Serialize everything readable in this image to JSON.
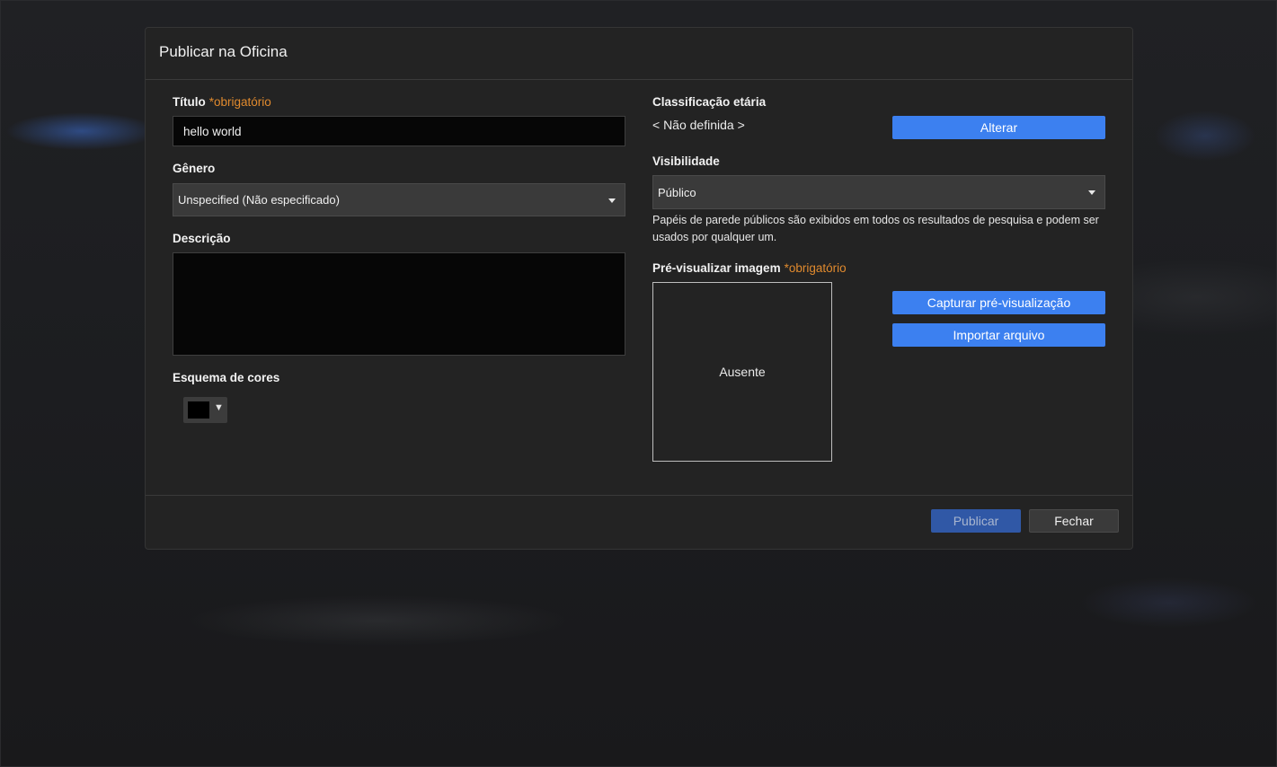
{
  "dialog": {
    "title": "Publicar na Oficina"
  },
  "form": {
    "title_label": "Título",
    "required_marker": "*obrigatório",
    "title_value": "hello world",
    "genre_label": "Gênero",
    "genre_selected": "Unspecified (Não especificado)",
    "description_label": "Descrição",
    "description_value": "",
    "color_scheme_label": "Esquema de cores",
    "color_scheme_value": "#000000"
  },
  "rating": {
    "label": "Classificação etária",
    "value": "< Não definida >",
    "change_button": "Alterar"
  },
  "visibility": {
    "label": "Visibilidade",
    "selected": "Público",
    "help_line1": "Papéis de parede públicos são exibidos em todos os resultados de pesquisa e podem ser",
    "help_line2": "usados por qualquer um."
  },
  "preview": {
    "label": "Pré-visualizar imagem",
    "placeholder": "Ausente",
    "capture_button": "Capturar pré-visualização",
    "import_button": "Importar arquivo"
  },
  "footer": {
    "publish_button": "Publicar",
    "close_button": "Fechar"
  },
  "colors": {
    "accent": "#3c80f0",
    "required": "#e08a2e",
    "publish_disabled": "#3058a6"
  }
}
